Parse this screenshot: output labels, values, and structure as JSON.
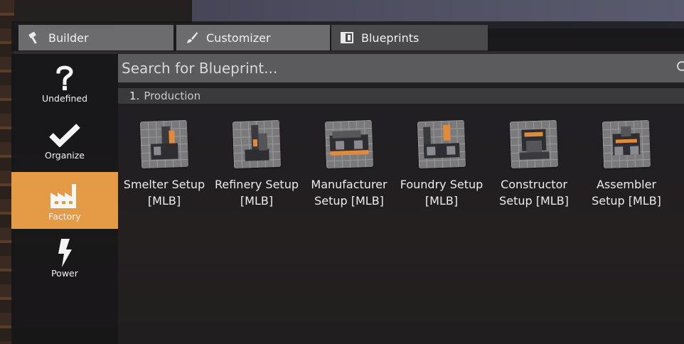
{
  "tabs": [
    {
      "label": "Builder",
      "icon": "hammer-icon"
    },
    {
      "label": "Customizer",
      "icon": "brush-icon"
    },
    {
      "label": "Blueprints",
      "icon": "blueprint-icon"
    }
  ],
  "sidebar": {
    "items": [
      {
        "label": "Undefined",
        "icon": "question-icon"
      },
      {
        "label": "Organize",
        "icon": "checkmark-icon"
      },
      {
        "label": "Factory",
        "icon": "factory-icon",
        "active": true
      },
      {
        "label": "Power",
        "icon": "lightning-icon"
      }
    ]
  },
  "search": {
    "placeholder": "Search for Blueprint..."
  },
  "section": {
    "number": "1.",
    "title": "Production"
  },
  "items": [
    {
      "line1": "Smelter Setup",
      "line2": "[MLB]"
    },
    {
      "line1": "Refinery Setup",
      "line2": "[MLB]"
    },
    {
      "line1": "Manufacturer",
      "line2": "Setup [MLB]"
    },
    {
      "line1": "Foundry Setup",
      "line2": "[MLB]"
    },
    {
      "line1": "Constructor",
      "line2": "Setup [MLB]"
    },
    {
      "line1": "Assembler",
      "line2": "Setup [MLB]"
    }
  ],
  "colors": {
    "accent": "#e59a45",
    "tab_active": "#4a4a4c",
    "tab_inactive": "#6c6c6e"
  }
}
